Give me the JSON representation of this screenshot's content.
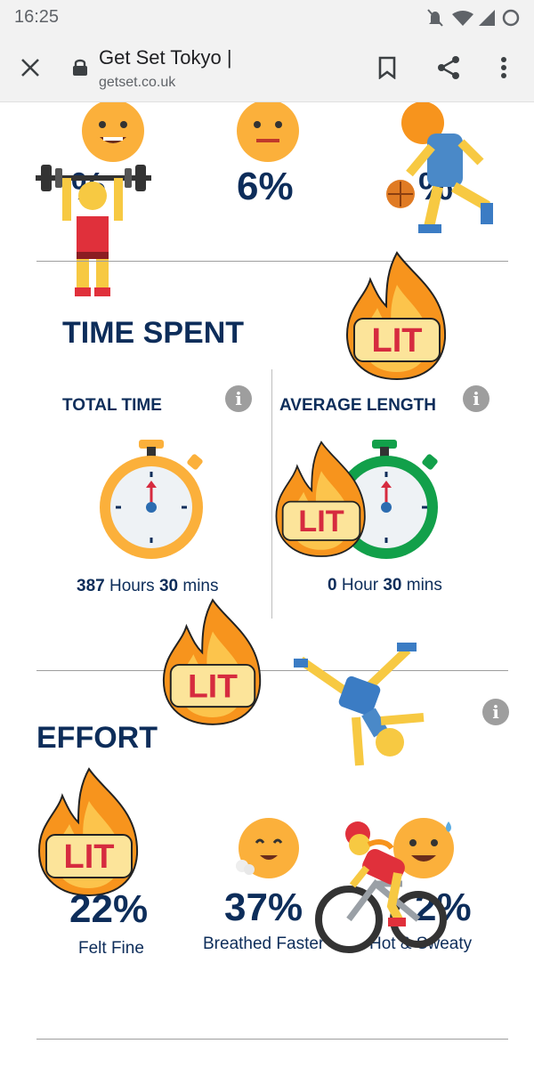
{
  "status_bar": {
    "time": "16:25"
  },
  "browser": {
    "page_title": "Get Set Tokyo |",
    "url": "getset.co.uk",
    "close_icon": "close-icon",
    "lock_icon": "lock-icon",
    "bookmark_icon": "bookmark-icon",
    "share_icon": "share-icon",
    "menu_icon": "more-vert-icon"
  },
  "mood_row": [
    {
      "percent": "%",
      "icon": "happy-face-icon"
    },
    {
      "percent": "6%",
      "icon": "neutral-face-icon"
    },
    {
      "percent": "%",
      "icon": "basketball-player-icon"
    }
  ],
  "time_spent": {
    "heading": "TIME SPENT",
    "total": {
      "title": "TOTAL TIME",
      "hours": "387",
      "hours_unit": "Hours",
      "mins": "30",
      "mins_unit": "mins"
    },
    "average": {
      "title": "AVERAGE LENGTH",
      "hours": "0",
      "hours_unit": "Hour",
      "mins": "30",
      "mins_unit": "mins"
    }
  },
  "effort": {
    "heading": "EFFORT",
    "items": [
      {
        "percent": "22%",
        "label": "Felt Fine"
      },
      {
        "percent": "37%",
        "label": "Breathed Faster"
      },
      {
        "percent": "2%",
        "label": "Hot & Sweaty"
      }
    ]
  },
  "stickers": {
    "lit_text": "LIT"
  },
  "colors": {
    "navy": "#0d2d5a",
    "amber": "#fbb03b",
    "green": "#12a04a",
    "red": "#d62b3f",
    "flame": "#f7941d"
  }
}
